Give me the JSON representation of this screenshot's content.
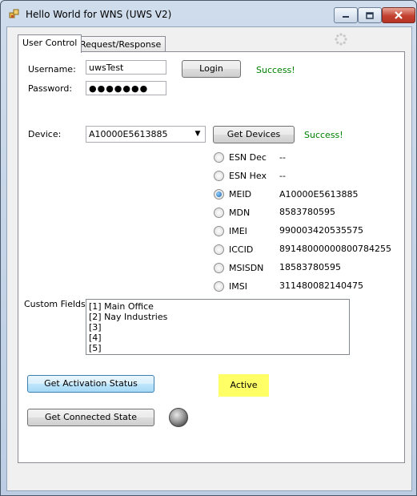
{
  "window": {
    "title": "Hello World for WNS (UWS V2)"
  },
  "tabs": [
    {
      "label": "User Control"
    },
    {
      "label": "Request/Response"
    }
  ],
  "login": {
    "username_label": "Username:",
    "username_value": "uwsTest",
    "password_label": "Password:",
    "password_value": "●●●●●●●",
    "login_button": "Login",
    "status": "Success!"
  },
  "device": {
    "label": "Device:",
    "selected": "A10000E5613885",
    "get_devices_button": "Get Devices",
    "status": "Success!"
  },
  "identifiers": [
    {
      "label": "ESN Dec",
      "value": "--",
      "checked": false
    },
    {
      "label": "ESN Hex",
      "value": "--",
      "checked": false
    },
    {
      "label": "MEID",
      "value": "A10000E5613885",
      "checked": true
    },
    {
      "label": "MDN",
      "value": "8583780595",
      "checked": false
    },
    {
      "label": "IMEI",
      "value": "990003420535575",
      "checked": false
    },
    {
      "label": "ICCID",
      "value": "89148000000800784255",
      "checked": false
    },
    {
      "label": "MSISDN",
      "value": "18583780595",
      "checked": false
    },
    {
      "label": "IMSI",
      "value": "311480082140475",
      "checked": false
    }
  ],
  "custom_fields": {
    "label": "Custom Fields:",
    "items": [
      "[1] Main Office",
      "[2] Nay Industries",
      "[3]",
      "[4]",
      "[5]"
    ]
  },
  "activation": {
    "button": "Get Activation Status",
    "status": "Active"
  },
  "connected": {
    "button": "Get Connected State"
  },
  "colors": {
    "success": "#008000",
    "active_highlight": "#ffff66"
  }
}
